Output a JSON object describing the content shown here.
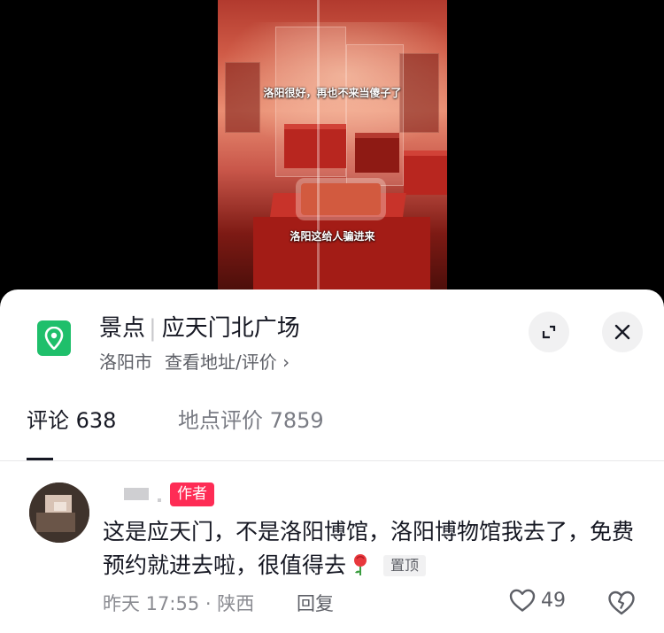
{
  "video": {
    "caption_top": "洛阳很好，再也不来当傻子了",
    "caption_bottom": "洛阳这给人骗进来"
  },
  "location": {
    "category": "景点",
    "name": "应天门北广场",
    "city": "洛阳市",
    "link": "查看地址/评价 ›",
    "icon": "map-pin-icon",
    "accent": "#1fbf6b"
  },
  "tabs": [
    {
      "label": "评论 638"
    },
    {
      "label": "地点评价 7859"
    }
  ],
  "comment": {
    "badge": "作者",
    "text": "这是应天门，不是洛阳博馆，洛阳博物馆我去了，免费预约就进去啦，很值得去",
    "pinned_label": "置顶",
    "time_location": "昨天 17:55 · 陕西",
    "reply_label": "回复",
    "likes": "49",
    "badge_color": "#fe2c55"
  }
}
